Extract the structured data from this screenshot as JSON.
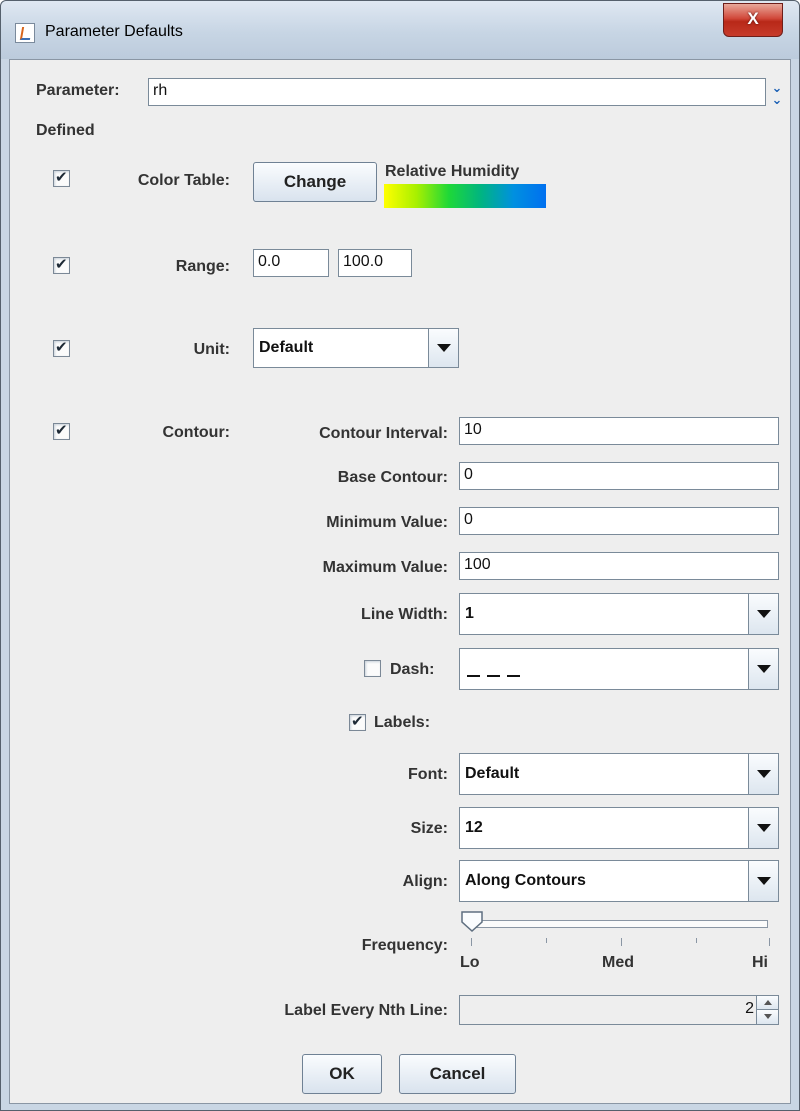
{
  "window": {
    "title": "Parameter Defaults",
    "close_label": "X"
  },
  "parameter": {
    "label": "Parameter:",
    "value": "rh"
  },
  "defined_label": "Defined",
  "color_table": {
    "label": "Color Table:",
    "change_label": "Change",
    "name": "Relative Humidity",
    "gradient": [
      "#ffff00",
      "#a8f000",
      "#1ed838",
      "#00b482",
      "#0090e0",
      "#0070f0"
    ]
  },
  "range": {
    "label": "Range:",
    "min": "0.0",
    "max": "100.0"
  },
  "unit": {
    "label": "Unit:",
    "value": "Default"
  },
  "contour": {
    "label": "Contour:",
    "interval_label": "Contour Interval:",
    "interval": "10",
    "base_label": "Base Contour:",
    "base": "0",
    "min_label": "Minimum Value:",
    "min": "0",
    "max_label": "Maximum Value:",
    "max": "100",
    "line_width_label": "Line Width:",
    "line_width": "1",
    "dash_label": "Dash:",
    "labels_label": "Labels:",
    "font_label": "Font:",
    "font": "Default",
    "size_label": "Size:",
    "size": "12",
    "align_label": "Align:",
    "align": "Along Contours",
    "frequency_label": "Frequency:",
    "frequency_ticks": [
      "Lo",
      "Med",
      "Hi"
    ],
    "frequency_level": 0,
    "nth_label": "Label Every Nth Line:",
    "nth": "2"
  },
  "buttons": {
    "ok": "OK",
    "cancel": "Cancel"
  }
}
